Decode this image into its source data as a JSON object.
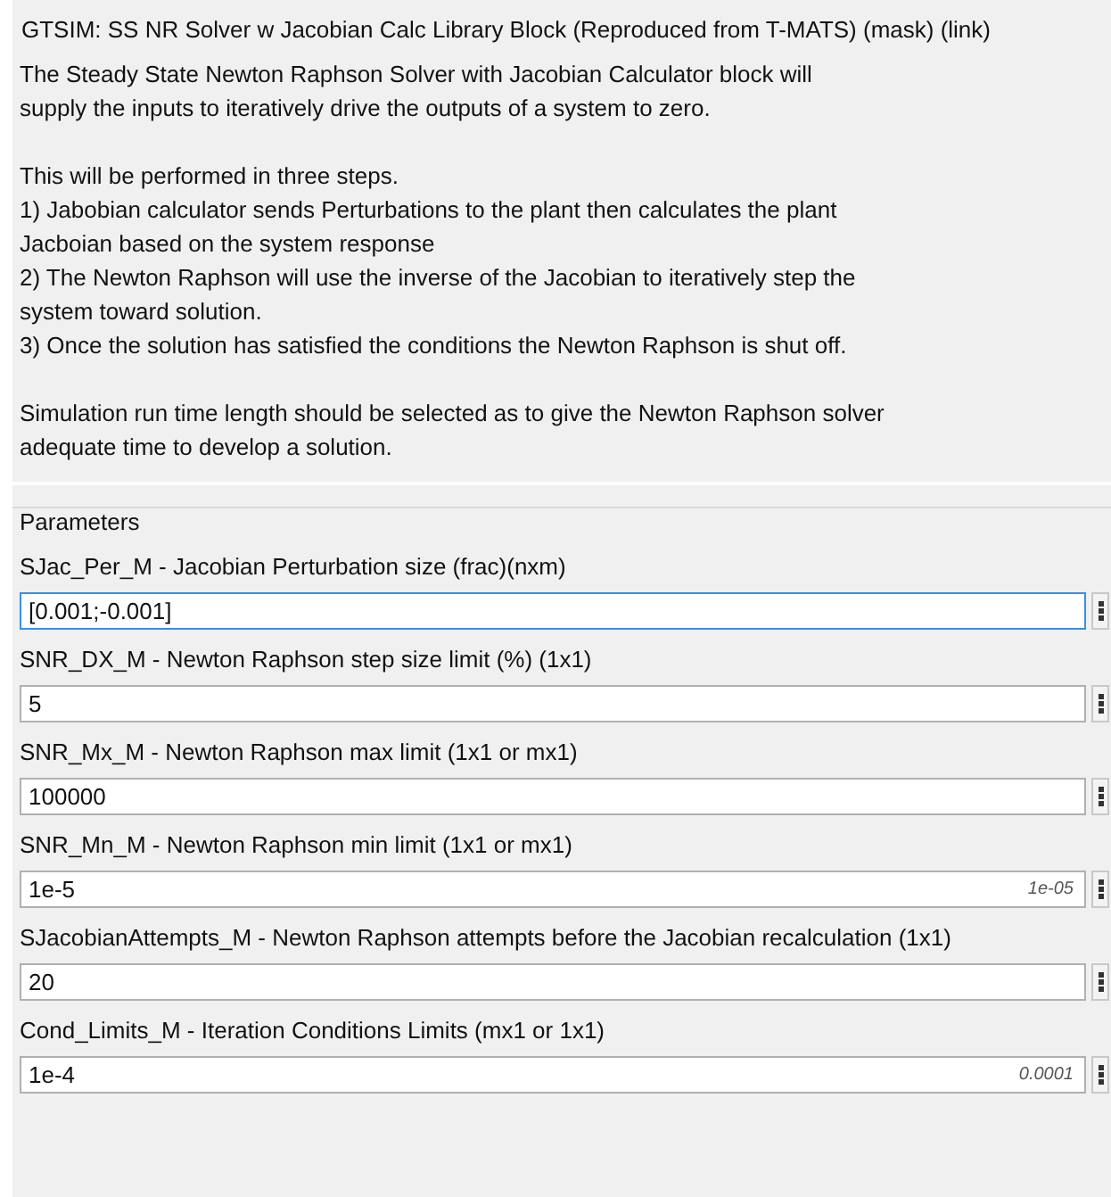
{
  "title": "GTSIM: SS NR Solver w Jacobian Calc Library Block (Reproduced from T-MATS) (mask) (link)",
  "description": [
    [
      "The Steady State Newton Raphson Solver with Jacobian Calculator block will",
      "supply the inputs to iteratively drive the outputs of a system to zero."
    ],
    [
      "This will be performed in three steps.",
      "1) Jabobian calculator sends Perturbations to the plant then calculates the plant",
      "Jacboian based on the system response",
      "2) The Newton Raphson will use the inverse of the Jacobian to iteratively step the",
      "system toward solution.",
      "3) Once the solution has satisfied the conditions the Newton Raphson is shut off."
    ],
    [
      "Simulation run time length should be selected as to give the Newton Raphson solver",
      "adequate time to develop a solution."
    ]
  ],
  "parameters": {
    "heading": "Parameters",
    "items": [
      {
        "label": "SJac_Per_M - Jacobian Perturbation size (frac)(nxm)",
        "value": "[0.001;-0.001]",
        "focused": true
      },
      {
        "label": "SNR_DX_M - Newton Raphson step size limit (%) (1x1)",
        "value": "5",
        "focused": false
      },
      {
        "label": "SNR_Mx_M - Newton Raphson max limit (1x1 or mx1)",
        "value": "100000",
        "focused": false
      },
      {
        "label": "SNR_Mn_M - Newton Raphson min limit (1x1 or mx1)",
        "value": "1e-5",
        "evaluated": "1e-05",
        "focused": false
      },
      {
        "label": "SJacobianAttempts_M - Newton Raphson attempts before the Jacobian recalculation (1x1)",
        "value": "20",
        "focused": false
      },
      {
        "label": "Cond_Limits_M - Iteration Conditions Limits (mx1 or 1x1)",
        "value": "1e-4",
        "evaluated": "0.0001",
        "focused": false
      }
    ]
  }
}
